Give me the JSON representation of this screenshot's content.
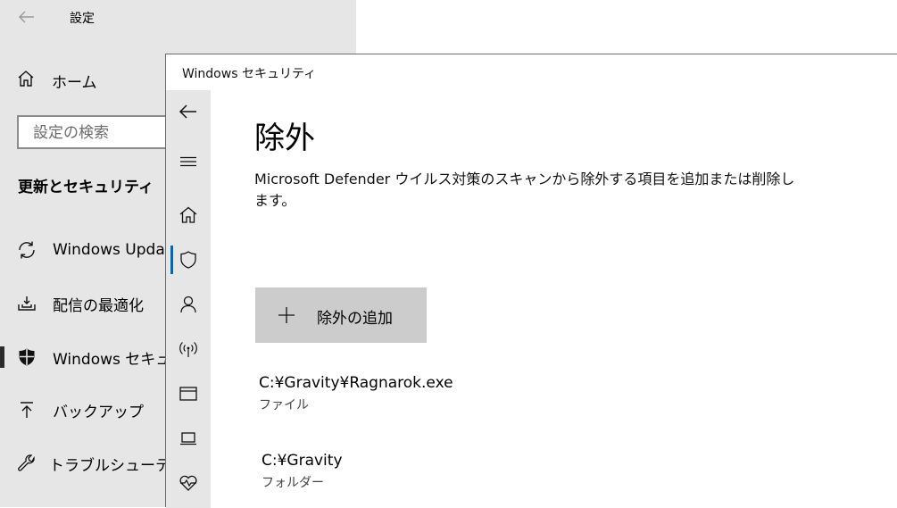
{
  "settings": {
    "title": "設定",
    "home_label": "ホーム",
    "search_placeholder": "設定の検索",
    "section_title": "更新とセキュリティ",
    "nav": [
      {
        "label": "Windows Upda",
        "icon": "sync-icon"
      },
      {
        "label": "配信の最適化",
        "icon": "delivery-optimization-icon"
      },
      {
        "label": "Windows セキュ",
        "icon": "shield-icon"
      },
      {
        "label": "バックアップ",
        "icon": "backup-arrow-icon"
      },
      {
        "label": "トラブルシューティン",
        "icon": "wrench-icon"
      }
    ]
  },
  "security": {
    "window_title": "Windows セキュリティ",
    "rail_icons": [
      "back-arrow-icon",
      "hamburger-menu-icon",
      "home-icon",
      "shield-icon",
      "account-icon",
      "wireless-icon",
      "app-browser-icon",
      "device-security-icon",
      "health-heart-icon"
    ],
    "page_title": "除外",
    "description": "Microsoft Defender ウイルス対策のスキャンから除外する項目を追加または削除します。",
    "add_button_label": "除外の追加",
    "exclusions": [
      {
        "path": "C:¥Gravity¥Ragnarok.exe",
        "type": "ファイル"
      },
      {
        "path": "C:¥Gravity",
        "type": "フォルダー"
      }
    ]
  },
  "colors": {
    "accent": "#0067c0",
    "settings_bg": "#e6e6e6",
    "button_bg": "#cccccc"
  }
}
